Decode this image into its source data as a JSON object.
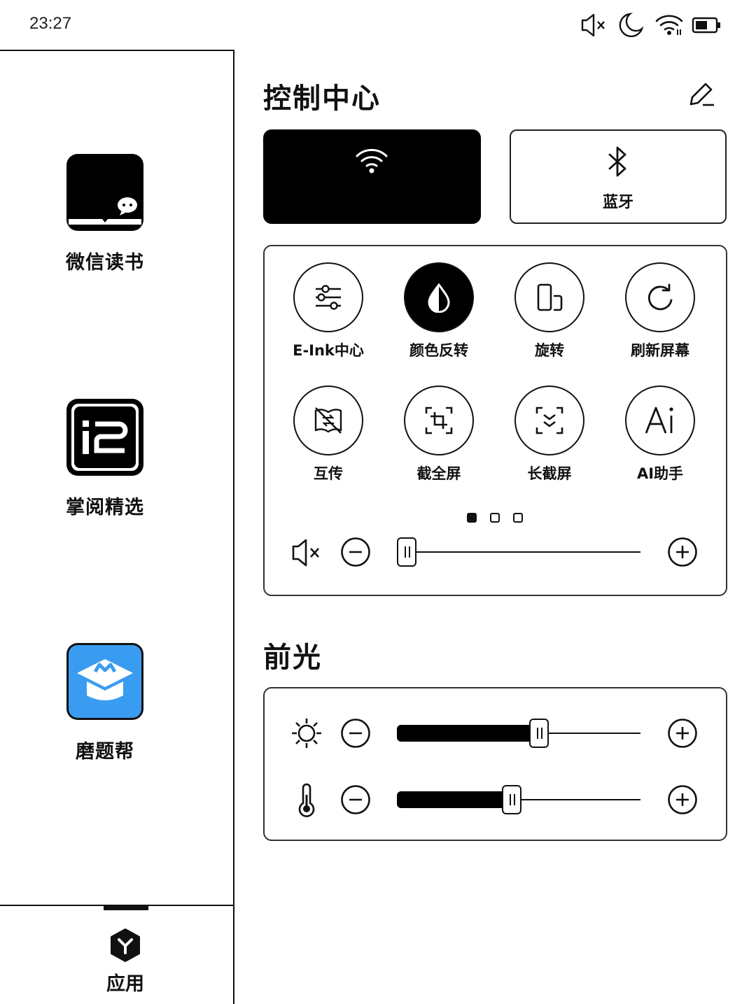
{
  "status_bar": {
    "time": "23:27",
    "icons": [
      "mute-icon",
      "moon-icon",
      "wifi-icon",
      "battery-icon"
    ]
  },
  "apps": [
    {
      "label": "微信读书",
      "icon": "wechat-read-icon"
    },
    {
      "label": "掌阅精选",
      "icon": "ireader-icon"
    },
    {
      "label": "磨题帮",
      "icon": "motibang-icon"
    }
  ],
  "dock": {
    "label": "应用",
    "icon": "apps-cube-icon"
  },
  "control_center": {
    "title": "控制中心",
    "wifi": {
      "state": "on",
      "icon": "wifi-icon"
    },
    "bluetooth": {
      "label": "蓝牙",
      "state": "off",
      "icon": "bluetooth-icon"
    },
    "controls": [
      {
        "label": "E-Ink中心",
        "icon": "sliders-icon",
        "active": false
      },
      {
        "label": "颜色反转",
        "icon": "drop-icon",
        "active": true
      },
      {
        "label": "旋转",
        "icon": "rotate-screen-icon",
        "active": false
      },
      {
        "label": "刷新屏幕",
        "icon": "refresh-icon",
        "active": false
      },
      {
        "label": "互传",
        "icon": "transfer-icon",
        "active": false
      },
      {
        "label": "截全屏",
        "icon": "crop-icon",
        "active": false
      },
      {
        "label": "长截屏",
        "icon": "long-screenshot-icon",
        "active": false
      },
      {
        "label": "AI助手",
        "icon": "ai-icon",
        "active": false
      }
    ],
    "page_indicator": {
      "current": 1,
      "total": 3
    },
    "volume": {
      "level": 0.0,
      "muted": true
    }
  },
  "front_light": {
    "title": "前光",
    "brightness": {
      "level": 0.59,
      "icon": "sun-icon"
    },
    "warmth": {
      "level": 0.47,
      "icon": "thermometer-icon"
    }
  },
  "colors": {
    "ink": "#000000",
    "background": "#ffffff",
    "motibang_blue": "#3a9cf0"
  }
}
